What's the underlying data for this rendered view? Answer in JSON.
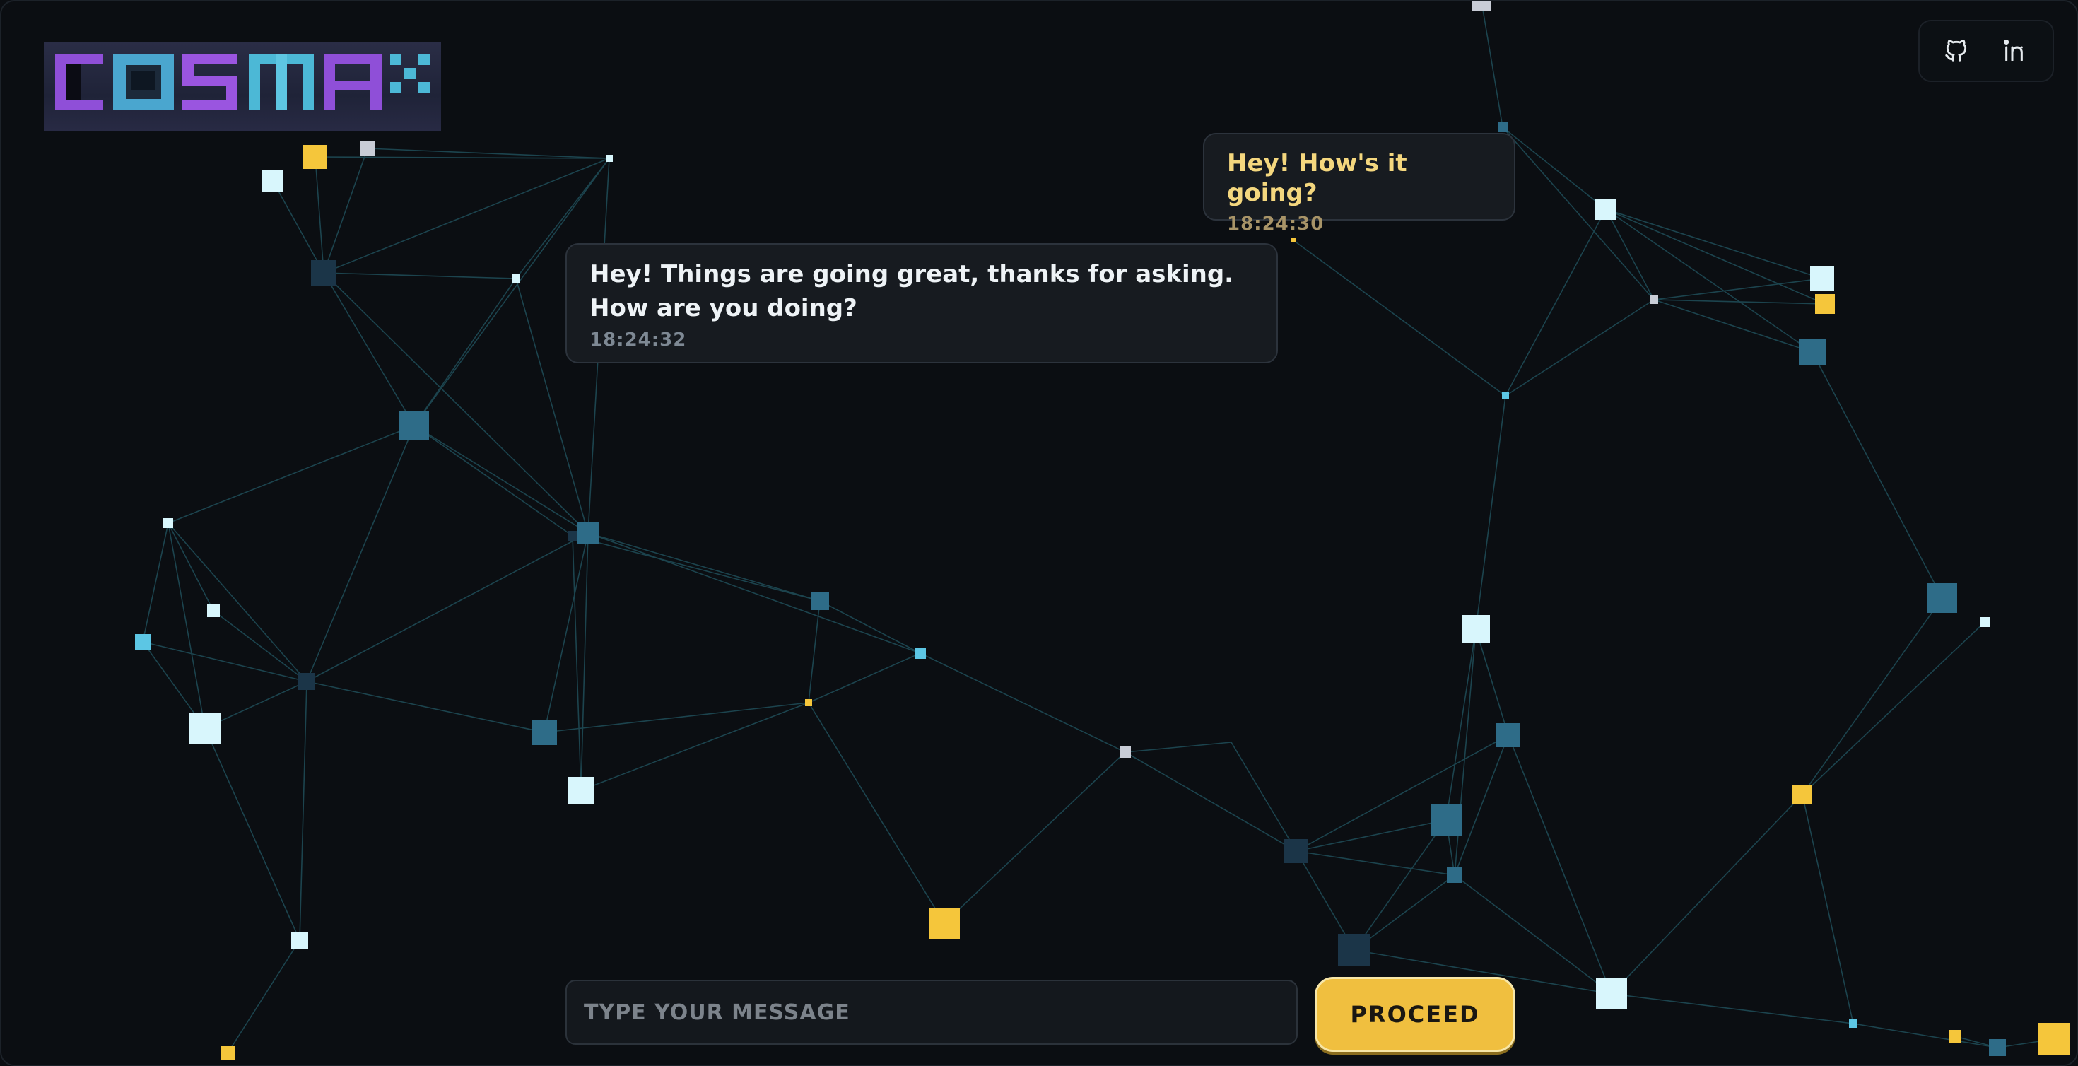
{
  "app": {
    "logo_text": "COSMAX"
  },
  "header": {
    "links": [
      {
        "icon": "github-icon",
        "label": "GitHub"
      },
      {
        "icon": "linkedin-icon",
        "label": "LinkedIn"
      }
    ]
  },
  "chat": {
    "messages": [
      {
        "role": "incoming",
        "text": "Hey! How's it going?",
        "time": "18:24:30"
      },
      {
        "role": "outgoing",
        "text_line1": "Hey! Things are going great, thanks for asking.",
        "text_line2": "How are you doing?",
        "time": "18:24:32"
      }
    ]
  },
  "composer": {
    "placeholder": "TYPE YOUR MESSAGE",
    "value": "",
    "submit_label": "PROCEED"
  },
  "colors": {
    "background": "#0b0e12",
    "accent_yellow": "#f0bf3f",
    "logo_purple": "#8f4fd8",
    "logo_cyan": "#4cb8d6",
    "node_teal": "#2d6b86",
    "node_pale": "#cdf3fb"
  }
}
